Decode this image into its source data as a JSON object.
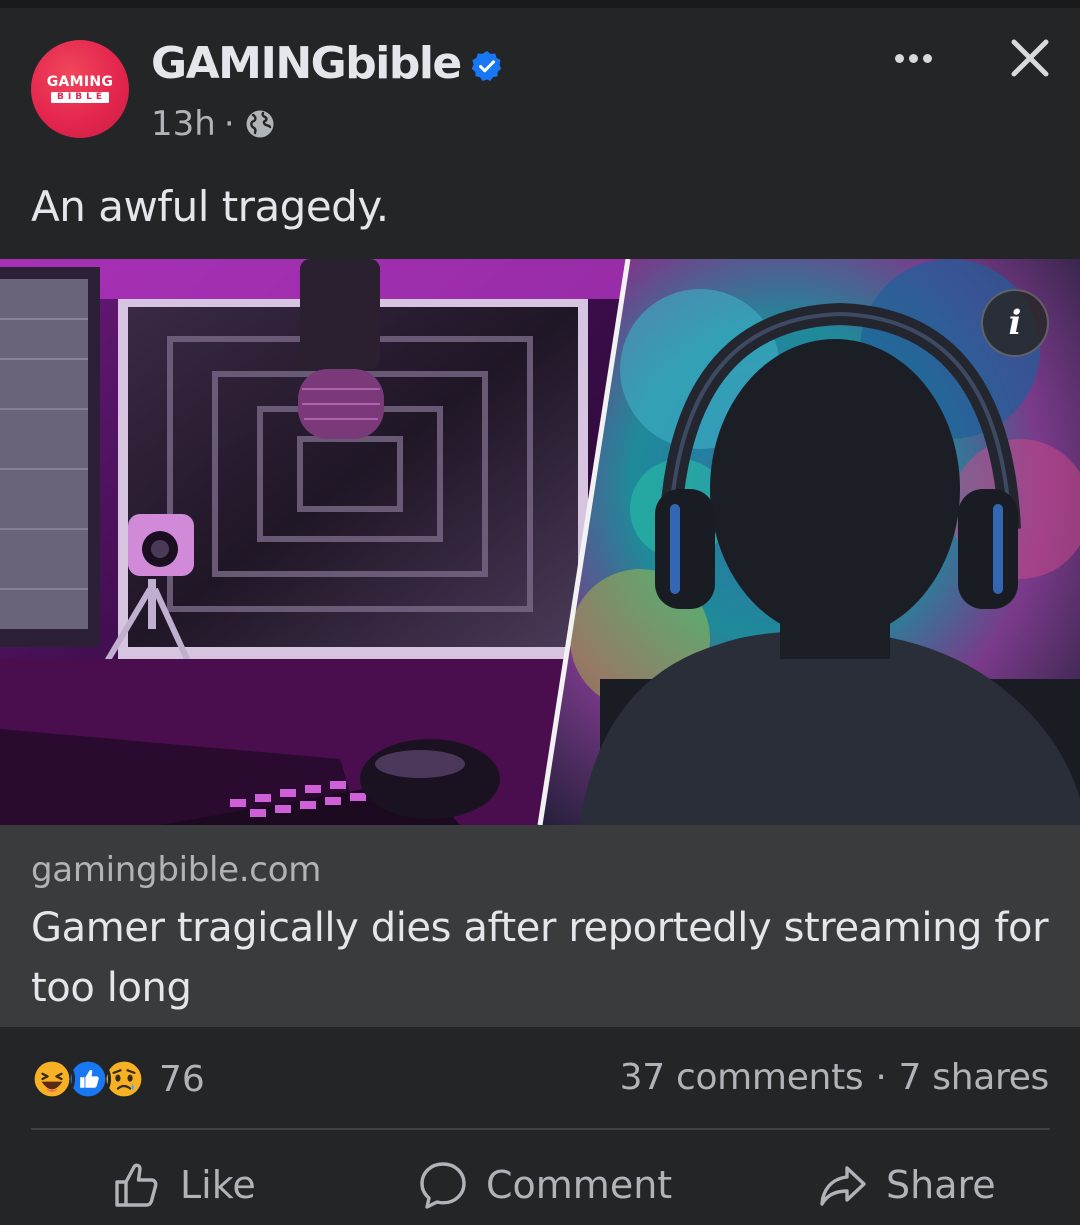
{
  "post": {
    "page_name": "GAMINGbible",
    "avatar_text_top": "GAMING",
    "avatar_text_bottom": "BIBLE",
    "time": "13h",
    "separator": "·",
    "caption": "An awful tragedy."
  },
  "link_preview": {
    "domain": "gamingbible.com",
    "headline": "Gamer tragically dies after reportedly streaming for too long"
  },
  "engagement": {
    "reaction_count": "76",
    "comments": "37 comments",
    "dot": "·",
    "shares": "7 shares",
    "reactions": [
      "haha-icon",
      "like-icon",
      "sad-icon"
    ]
  },
  "actions": {
    "like": "Like",
    "comment": "Comment",
    "share": "Share"
  },
  "colors": {
    "background": "#242526",
    "link_background": "#3a3b3c",
    "verified_blue": "#1877f2",
    "brand_red": "#e4264e"
  }
}
